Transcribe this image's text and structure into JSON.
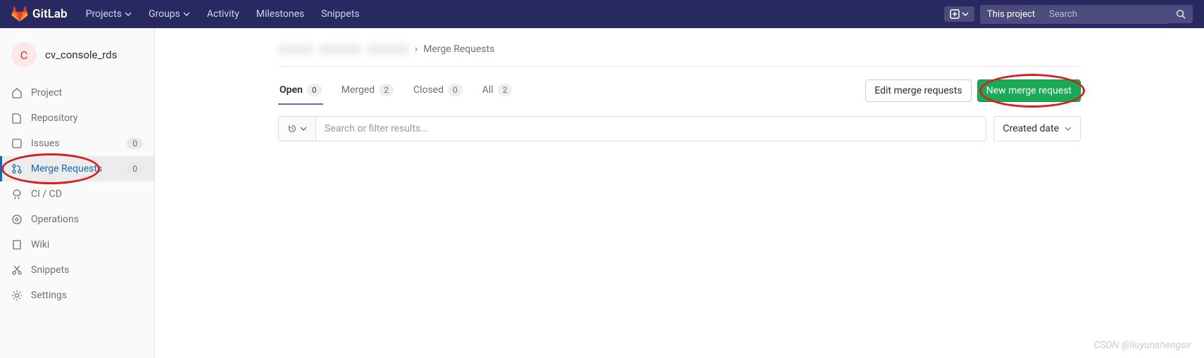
{
  "brand": "GitLab",
  "nav": {
    "projects": "Projects",
    "groups": "Groups",
    "activity": "Activity",
    "milestones": "Milestones",
    "snippets": "Snippets"
  },
  "search": {
    "scope": "This project",
    "placeholder": "Search"
  },
  "project": {
    "initial": "C",
    "name": "cv_console_rds"
  },
  "sidebar": {
    "project": "Project",
    "repository": "Repository",
    "issues": "Issues",
    "issues_count": "0",
    "merge_requests": "Merge Requests",
    "mr_count": "0",
    "cicd": "CI / CD",
    "operations": "Operations",
    "wiki": "Wiki",
    "snippets": "Snippets",
    "settings": "Settings"
  },
  "breadcrumb": {
    "current": "Merge Requests"
  },
  "tabs": {
    "open": {
      "label": "Open",
      "count": "0"
    },
    "merged": {
      "label": "Merged",
      "count": "2"
    },
    "closed": {
      "label": "Closed",
      "count": "0"
    },
    "all": {
      "label": "All",
      "count": "2"
    }
  },
  "buttons": {
    "edit": "Edit merge requests",
    "new": "New merge request"
  },
  "filter": {
    "placeholder": "Search or filter results...",
    "sort": "Created date"
  },
  "watermark": "CSDN @liuyunshengsir"
}
